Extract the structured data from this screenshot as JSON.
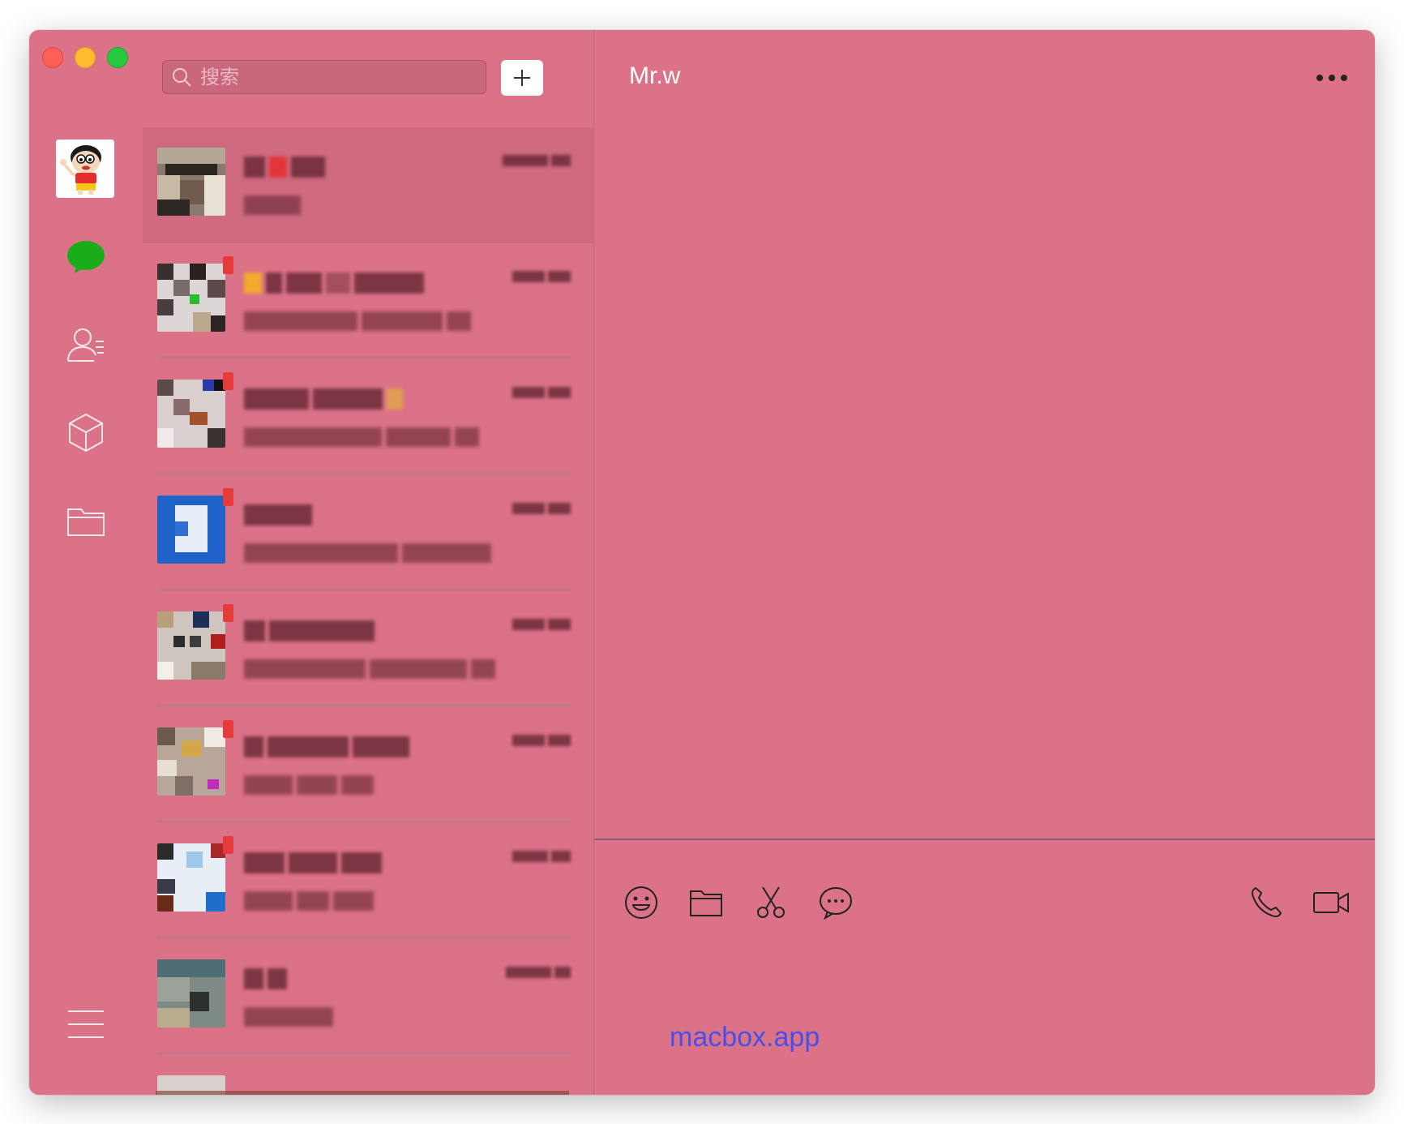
{
  "window": {
    "background_color": "#db7288",
    "traffic_lights": [
      "close",
      "minimize",
      "zoom"
    ]
  },
  "nav": {
    "items": [
      {
        "name": "chats",
        "icon": "chat-bubble-icon",
        "active": true
      },
      {
        "name": "contacts",
        "icon": "contacts-icon"
      },
      {
        "name": "mini-programs",
        "icon": "cube-icon"
      },
      {
        "name": "files",
        "icon": "folder-icon"
      }
    ],
    "menu_icon": "hamburger-menu-icon",
    "active_color": "#1aad19"
  },
  "search": {
    "placeholder": "搜索",
    "value": ""
  },
  "chat_list": {
    "selected_index": 0,
    "items_visible": 8,
    "note": ""
  },
  "conversation": {
    "title": "Mr.w",
    "toolbar": {
      "left_icons": [
        "emoji-icon",
        "folder-icon",
        "scissors-icon",
        "chat-history-icon"
      ],
      "right_icons": [
        "phone-call-icon",
        "video-call-icon"
      ]
    },
    "separator_color": "#8e5a75"
  },
  "watermark": {
    "text": "macbox.app",
    "color": "#4a4ee8"
  }
}
